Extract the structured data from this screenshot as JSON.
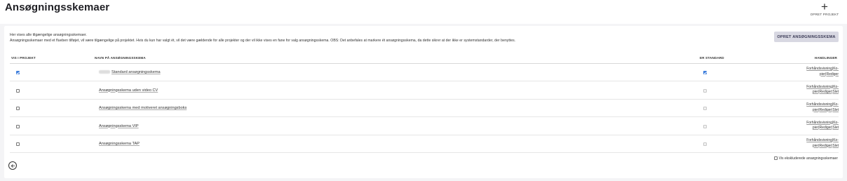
{
  "header": {
    "title": "Ansøgningsskemaer",
    "create_project_icon": "plus-icon",
    "create_project_label": "OPRET PROJEKT"
  },
  "intro": {
    "line1": "Her vises alle tilgængelige ansøgningsskemaer.",
    "line2": "Ansøgningsskemaer med et flueben tilføjet, vil være tilgængelige på projektet. Hvis du kun har valgt ét, vil det være gældende for alle projekter og der vil ikke vises en fane for valg ansøgningsskema. OBS: Det anbefales at markere ét ansøgningsskema, da dette sikrer at der ikke er systemstandarder, der benyttes."
  },
  "create_form_label": "OPRET ANSØGNINGSSKEMA",
  "table": {
    "columns": {
      "visible": "VIS I PROJEKT",
      "name": "NAVN PÅ ANSØGNINGSSKEMA",
      "default": "ER STANDARD",
      "actions": "HANDLINGER"
    },
    "rows": [
      {
        "name": "Standard ansøgningsskema",
        "visible": true,
        "default": true,
        "actions": [
          "Forhåndsvisning",
          "Ko-",
          "pier",
          "Rediger"
        ]
      },
      {
        "name": "Ansøgningsskema uden video CV",
        "visible": false,
        "default": false,
        "actions": [
          "Forhåndsvisning",
          "Ko-",
          "pier",
          "Rediger",
          "Slet"
        ]
      },
      {
        "name": "Ansøgningsskema med motiveret ansøgningsboks",
        "visible": false,
        "default": false,
        "actions": [
          "Forhåndsvisning",
          "Ko-",
          "pier",
          "Rediger",
          "Slet"
        ]
      },
      {
        "name": "Ansøgningsskema VIP",
        "visible": false,
        "default": false,
        "actions": [
          "Forhåndsvisning",
          "Ko-",
          "pier",
          "Rediger",
          "Slet"
        ]
      },
      {
        "name": "Ansøgningsskema TAP",
        "visible": false,
        "default": false,
        "actions": [
          "Forhåndsvisning",
          "Ko-",
          "pier",
          "Rediger",
          "Slet"
        ]
      }
    ]
  },
  "show_excluded_label": "Vis ekskluderede ansøgningsskemaer",
  "back_icon": "arrow-left-circle-icon",
  "colors": {
    "accent": "#3f7fdc",
    "button_bg": "#d8d8e2"
  }
}
